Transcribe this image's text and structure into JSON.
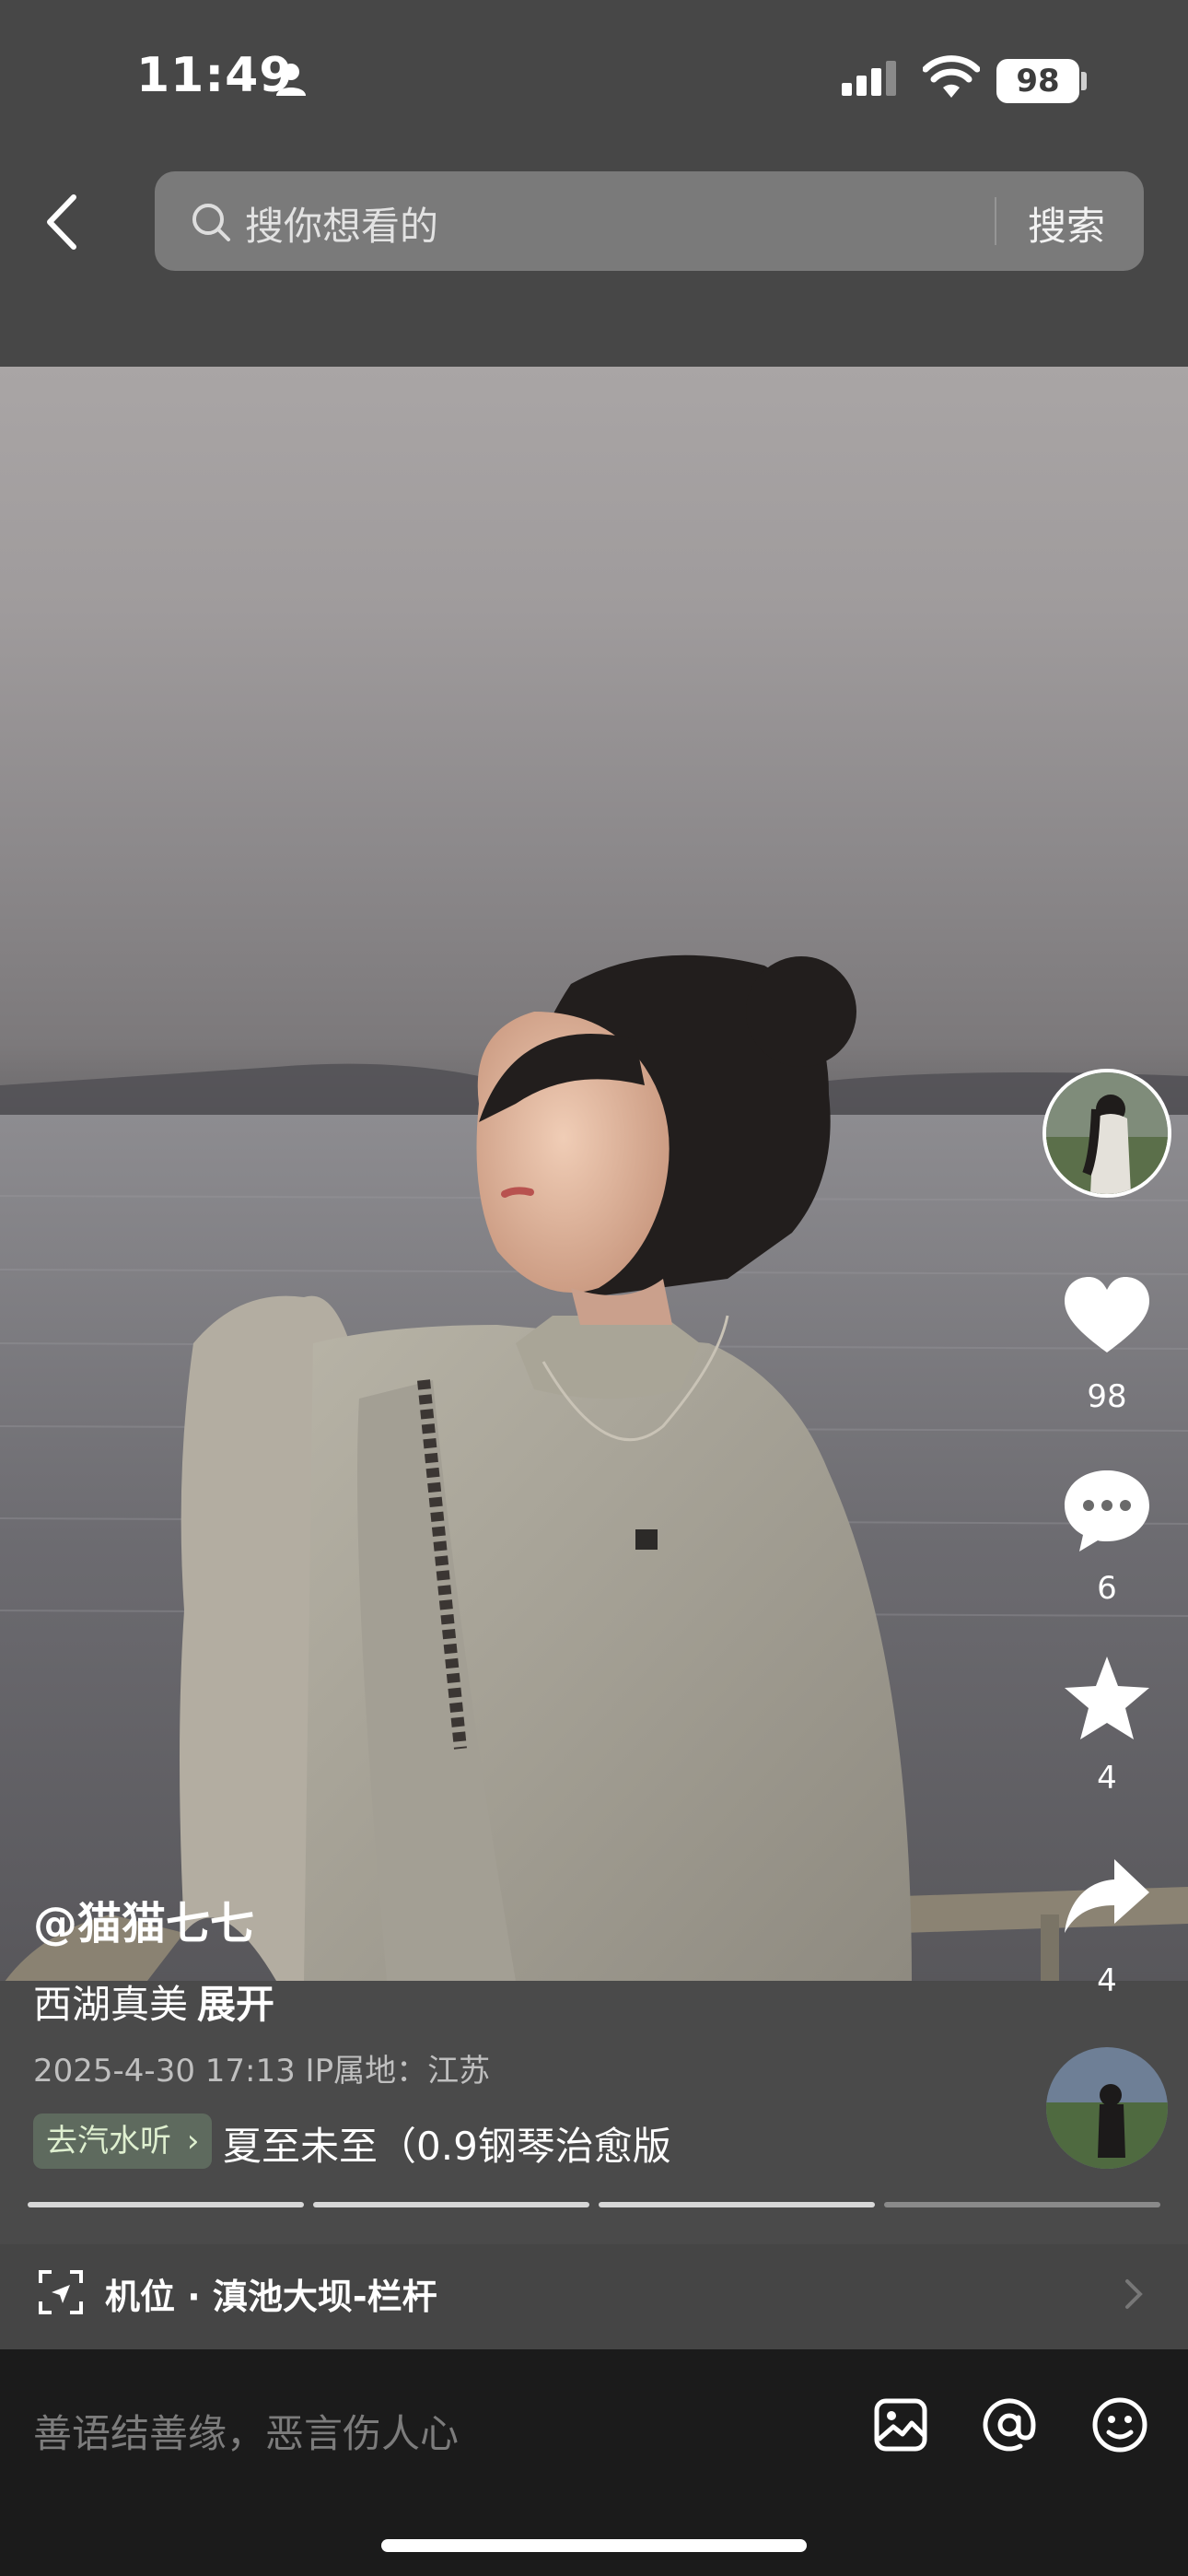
{
  "status_bar": {
    "time": "11:49",
    "battery": "98"
  },
  "search": {
    "placeholder": "搜你想看的",
    "button": "搜索"
  },
  "actions": {
    "likes": "98",
    "comments": "6",
    "favorites": "4",
    "shares": "4"
  },
  "post": {
    "author": "@猫猫七七",
    "caption": "西湖真美",
    "expand": "展开",
    "meta": "2025-4-30 17:13  IP属地：江苏",
    "music_chip": "去汽水听",
    "music_title": "夏至未至（0.9钢琴治愈版"
  },
  "gallery": {
    "pages": 4,
    "current_page": 3
  },
  "location": {
    "label": "机位 · 滇池大坝-栏杆"
  },
  "comment": {
    "placeholder": "善语结善缘，恶言伤人心"
  }
}
